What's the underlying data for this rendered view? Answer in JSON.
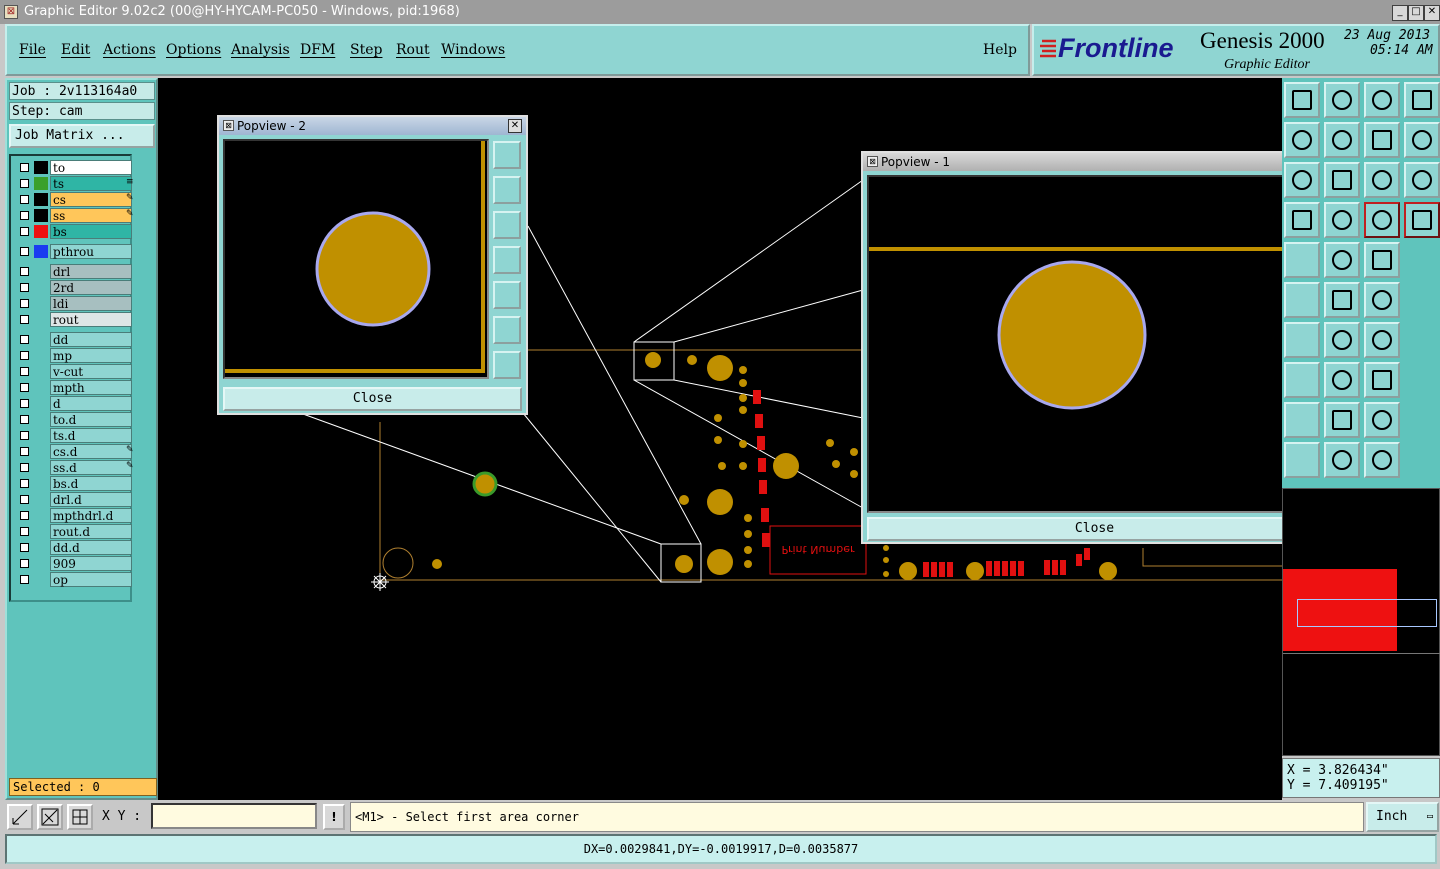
{
  "window": {
    "title": "Graphic Editor 9.02c2 (00@HY-HYCAM-PC050 - Windows, pid:1968)",
    "min": "_",
    "max": "□",
    "close": "✕"
  },
  "menu": [
    "File",
    "Edit",
    "Actions",
    "Options",
    "Analysis",
    "DFM",
    "Step",
    "Rout",
    "Windows"
  ],
  "help_label": "Help",
  "brand": {
    "logo": "Frontline",
    "product": "Genesis 2000",
    "sub": "Graphic Editor",
    "date": "23 Aug 2013",
    "time": "05:14 AM"
  },
  "job": {
    "job": "Job : 2v113164a0",
    "step": "Step: cam",
    "matrix_button": "Job Matrix ..."
  },
  "layers": [
    {
      "name": "to",
      "bg": "#ffffff",
      "swatch": "#000000",
      "flag": ""
    },
    {
      "name": "ts",
      "bg": "#2fb5a5",
      "swatch": "#3aa02a",
      "flag": "≡"
    },
    {
      "name": "cs",
      "bg": "#ffc65a",
      "swatch": "#000000",
      "flag": "✎"
    },
    {
      "name": "ss",
      "bg": "#ffc65a",
      "swatch": "#000000",
      "flag": "✎"
    },
    {
      "name": "bs",
      "bg": "#2fb5a5",
      "swatch": "#ee1111",
      "flag": ""
    },
    {
      "name": "pthrou",
      "bg": "#8fd5d2",
      "swatch": "#1a3cf0",
      "flag": ""
    },
    {
      "name": "drl",
      "bg": "#a7bfc0",
      "swatch": "",
      "flag": ""
    },
    {
      "name": "2rd",
      "bg": "#a7bfc0",
      "swatch": "",
      "flag": ""
    },
    {
      "name": "ldi",
      "bg": "#a7bfc0",
      "swatch": "",
      "flag": ""
    },
    {
      "name": "rout",
      "bg": "#dde6e6",
      "swatch": "",
      "flag": ""
    },
    {
      "name": "dd",
      "bg": "#8fd5d2",
      "swatch": "",
      "flag": ""
    },
    {
      "name": "mp",
      "bg": "#8fd5d2",
      "swatch": "",
      "flag": ""
    },
    {
      "name": "v-cut",
      "bg": "#8fd5d2",
      "swatch": "",
      "flag": ""
    },
    {
      "name": "mpth",
      "bg": "#8fd5d2",
      "swatch": "",
      "flag": ""
    },
    {
      "name": "d",
      "bg": "#8fd5d2",
      "swatch": "",
      "flag": ""
    },
    {
      "name": "to.d",
      "bg": "#8fd5d2",
      "swatch": "",
      "flag": ""
    },
    {
      "name": "ts.d",
      "bg": "#8fd5d2",
      "swatch": "",
      "flag": ""
    },
    {
      "name": "cs.d",
      "bg": "#8fd5d2",
      "swatch": "",
      "flag": "✎"
    },
    {
      "name": "ss.d",
      "bg": "#8fd5d2",
      "swatch": "",
      "flag": "✎"
    },
    {
      "name": "bs.d",
      "bg": "#8fd5d2",
      "swatch": "",
      "flag": ""
    },
    {
      "name": "drl.d",
      "bg": "#8fd5d2",
      "swatch": "",
      "flag": ""
    },
    {
      "name": "mpthdrl.d",
      "bg": "#8fd5d2",
      "swatch": "",
      "flag": ""
    },
    {
      "name": "rout.d",
      "bg": "#8fd5d2",
      "swatch": "",
      "flag": ""
    },
    {
      "name": "dd.d",
      "bg": "#8fd5d2",
      "swatch": "",
      "flag": ""
    },
    {
      "name": "909",
      "bg": "#8fd5d2",
      "swatch": "",
      "flag": ""
    },
    {
      "name": "op",
      "bg": "#8fd5d2",
      "swatch": "",
      "flag": ""
    }
  ],
  "selected": "Selected : 0",
  "popview2": {
    "title": "Popview - 2",
    "close": "Close"
  },
  "popview1": {
    "title": "Popview - 1",
    "close": "Close"
  },
  "board_text": "Print Number",
  "coords": {
    "x": "X = 3.826434\"",
    "y": "Y = 7.409195\""
  },
  "status": {
    "xy_label": "X Y :",
    "xy_value": "",
    "prompt": "<M1> - Select first area corner",
    "units": "Inch"
  },
  "measure": "DX=0.0029841,DY=-0.0019917,D=0.0035877",
  "colors": {
    "teal": "#8fd5d2",
    "pad": "#c09000",
    "trace": "#e01010"
  }
}
